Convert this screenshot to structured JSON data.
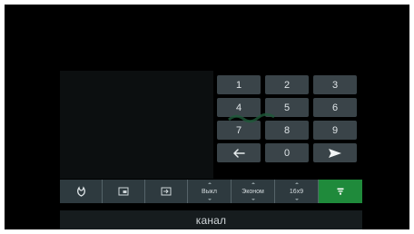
{
  "keypad": {
    "keys": [
      {
        "label": "1",
        "name": "key-1"
      },
      {
        "label": "2",
        "name": "key-2"
      },
      {
        "label": "3",
        "name": "key-3"
      },
      {
        "label": "4",
        "name": "key-4"
      },
      {
        "label": "5",
        "name": "key-5"
      },
      {
        "label": "6",
        "name": "key-6"
      },
      {
        "label": "7",
        "name": "key-7"
      },
      {
        "label": "8",
        "name": "key-8"
      },
      {
        "label": "9",
        "name": "key-9"
      },
      {
        "icon": "backspace-arrow-icon",
        "name": "key-backspace"
      },
      {
        "label": "0",
        "name": "key-0"
      },
      {
        "icon": "send-arrow-icon",
        "name": "key-enter"
      }
    ]
  },
  "toolbar": {
    "items": [
      {
        "icon": "tv-antenna-icon",
        "name": "toolbar-source-button"
      },
      {
        "icon": "picture-in-picture-icon",
        "name": "toolbar-pip-button"
      },
      {
        "icon": "input-icon",
        "name": "toolbar-input-button"
      },
      {
        "label": "Выкл",
        "name": "toolbar-off-button"
      },
      {
        "label": "Эконом",
        "name": "toolbar-economy-button"
      },
      {
        "label": "16x9",
        "name": "toolbar-aspect-button"
      },
      {
        "icon": "channel-list-icon",
        "name": "toolbar-channel-button",
        "active": true
      }
    ]
  },
  "status": {
    "label": "канал"
  },
  "colors": {
    "accent": "#1f8a3b",
    "key_bg": "#3a4449",
    "toolbar_bg": "#2e3a3f"
  }
}
